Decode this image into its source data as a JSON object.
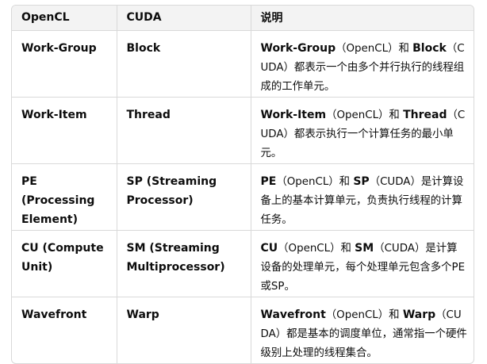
{
  "table": {
    "headers": [
      "OpenCL",
      "CUDA",
      "说明"
    ],
    "rows": [
      {
        "opencl": "Work-Group",
        "cuda": "Block",
        "desc": {
          "term1": "Work-Group",
          "mid1": "（OpenCL）和 ",
          "term2": "Block",
          "rest": "（CUDA）都表示一个由多个并行执行的线程组成的工作单元。"
        }
      },
      {
        "opencl": "Work-Item",
        "cuda": "Thread",
        "desc": {
          "term1": "Work-Item",
          "mid1": "（OpenCL）和 ",
          "term2": "Thread",
          "rest": "（CUDA）都表示执行一个计算任务的最小单元。"
        }
      },
      {
        "opencl": "PE (Processing Element)",
        "cuda": "SP (Streaming Processor)",
        "desc": {
          "term1": "PE",
          "mid1": "（OpenCL）和 ",
          "term2": "SP",
          "rest": "（CUDA）是计算设备上的基本计算单元，负责执行线程的计算任务。"
        }
      },
      {
        "opencl": "CU (Compute Unit)",
        "cuda": "SM (Streaming Multiprocessor)",
        "desc": {
          "term1": "CU",
          "mid1": "（OpenCL）和 ",
          "term2": "SM",
          "rest": "（CUDA）是计算设备的处理单元，每个处理单元包含多个PE或SP。"
        }
      },
      {
        "opencl": "Wavefront",
        "cuda": "Warp",
        "desc": {
          "term1": "Wavefront",
          "mid1": "（OpenCL）和 ",
          "term2": "Warp",
          "rest": "（CUDA）都是基本的调度单位，通常指一个硬件级别上处理的线程集合。"
        }
      }
    ]
  }
}
